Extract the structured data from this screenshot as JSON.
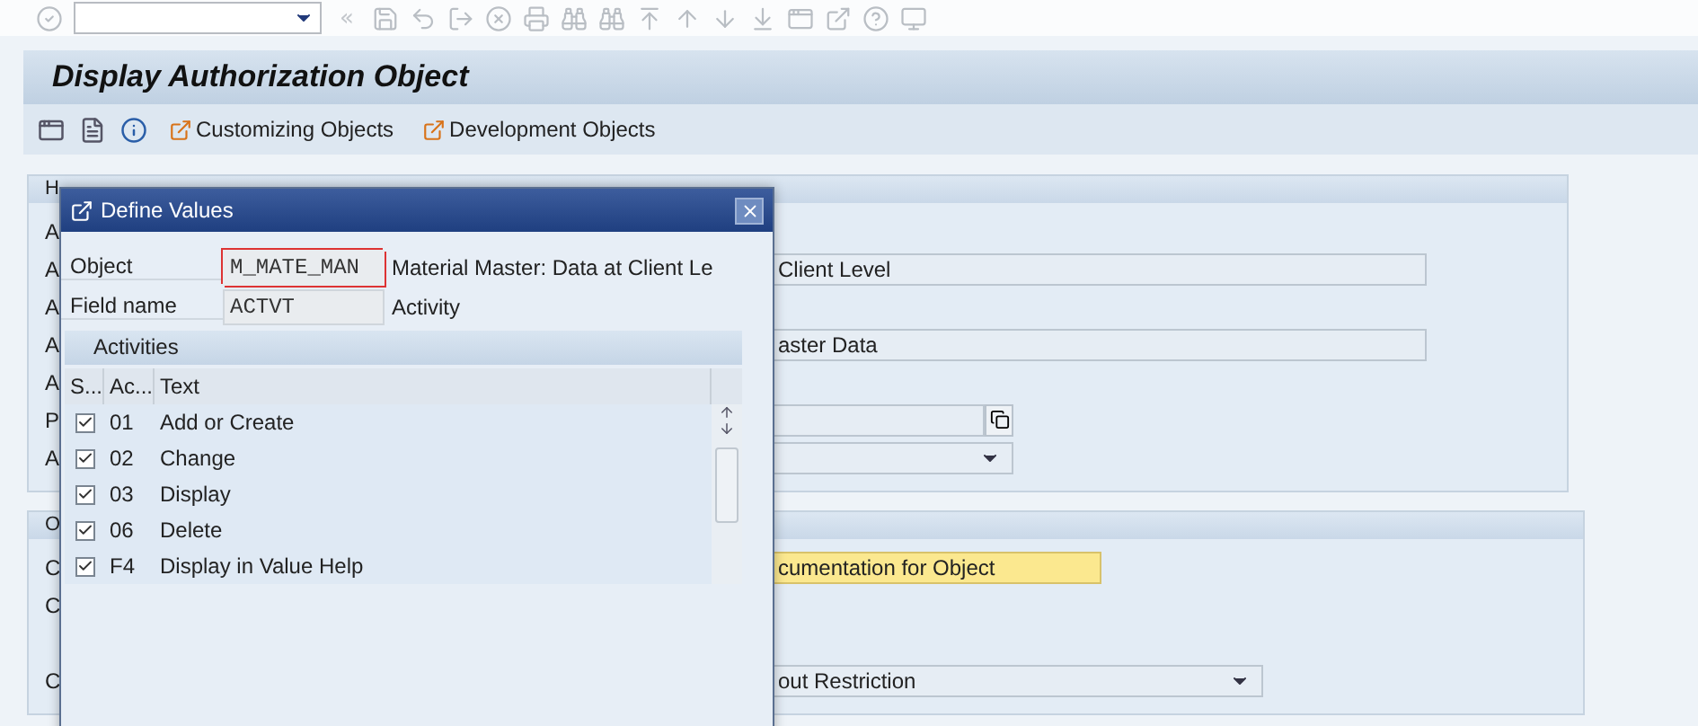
{
  "system_toolbar": {
    "back_chevrons": "«"
  },
  "title": "Display Authorization Object",
  "app_toolbar": {
    "buttons": [
      {
        "label": "Customizing Objects"
      },
      {
        "label": "Development Objects"
      }
    ]
  },
  "header_group": {
    "title": "H",
    "rows": [
      {
        "label": "A",
        "kind": "label"
      },
      {
        "label": "A",
        "kind": "long_field",
        "value": "Client Level"
      },
      {
        "label": "A",
        "kind": "label"
      },
      {
        "label": "A",
        "kind": "long_field",
        "value": "aster Data"
      },
      {
        "label": "A",
        "kind": "label"
      },
      {
        "label": "P",
        "kind": "field_button"
      },
      {
        "label": "A",
        "kind": "short_dropdown"
      }
    ]
  },
  "options_group": {
    "title": "O",
    "rows": [
      {
        "label": "C",
        "kind": "highlight_field",
        "value": "cumentation for Object"
      },
      {
        "label": "C",
        "kind": "label"
      },
      {
        "kind": "label"
      },
      {
        "label": "C",
        "kind": "wide_dropdown",
        "value": "out Restriction"
      }
    ]
  },
  "dialog": {
    "title": "Define Values",
    "object": {
      "label": "Object",
      "value": "M_MATE_MAN",
      "description": "Material Master: Data at Client Le"
    },
    "field": {
      "label": "Field name",
      "value": "ACTVT",
      "description": "Activity"
    },
    "table": {
      "title": "Activities",
      "columns": [
        "S...",
        "Ac...",
        "Text"
      ],
      "rows": [
        {
          "checked": true,
          "code": "01",
          "text": "Add or Create"
        },
        {
          "checked": true,
          "code": "02",
          "text": "Change"
        },
        {
          "checked": true,
          "code": "03",
          "text": "Display"
        },
        {
          "checked": true,
          "code": "06",
          "text": "Delete"
        },
        {
          "checked": true,
          "code": "F4",
          "text": "Display in Value Help"
        }
      ]
    }
  }
}
